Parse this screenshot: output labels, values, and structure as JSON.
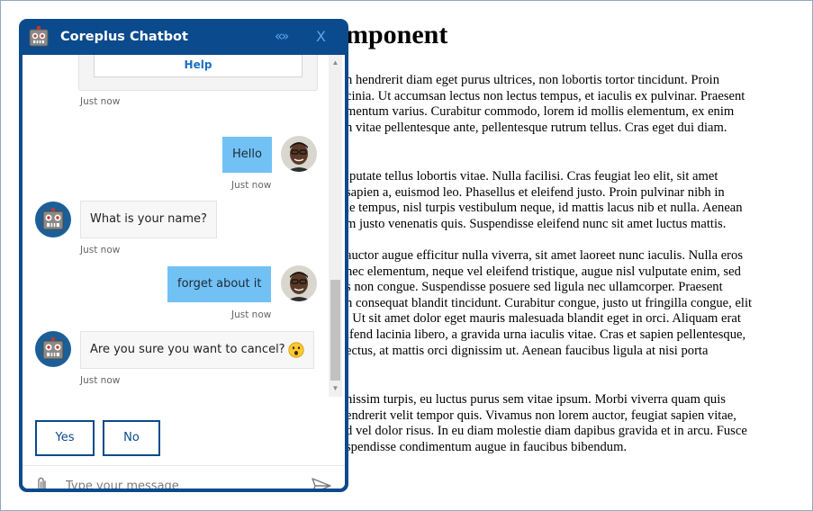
{
  "page": {
    "heading": "mponent",
    "paragraphs": [
      [
        "n hendrerit diam eget purus ultrices, non lobortis tortor tincidunt. Proin",
        "cinia. Ut accumsan lectus non lectus tempus, et iaculis ex pulvinar. Praesent",
        "mentum varius. Curabitur commodo, lorem id mollis elementum, ex enim",
        "n vitae pellentesque ante, pellentesque rutrum tellus. Cras eget dui diam."
      ],
      [
        "lputate tellus lobortis vitae. Nulla facilisi. Cras feugiat leo elit, sit amet",
        "sapien a, euismod leo. Phasellus et eleifend justo. Proin pulvinar nibh in",
        "ie tempus, nisl turpis vestibulum neque, id mattis lacus nib et nulla. Aenean",
        "m justo venenatis quis. Suspendisse eleifend nunc sit amet luctus mattis."
      ],
      [
        "auctor augue efficitur nulla viverra, sit amet laoreet nunc iaculis. Nulla eros",
        "nec elementum, neque vel eleifend tristique, augue nisl vulputate enim, sed",
        "s non congue. Suspendisse posuere sed ligula nec ullamcorper. Praesent",
        "n consequat blandit tincidunt. Curabitur congue, justo ut fringilla congue, elit",
        ". Ut sit amet dolor eget mauris malesuada blandit eget in orci. Aliquam erat",
        "ifend lacinia libero, a gravida urna iaculis vitae. Cras et sapien pellentesque,",
        "ectus, at mattis orci dignissim ut. Aenean faucibus ligula at nisi porta"
      ],
      [
        "nissim turpis, eu luctus purus sem vitae ipsum. Morbi viverra quam quis",
        "endrerit velit tempor quis. Vivamus non lorem auctor, feugiat sapien vitae,",
        "d vel dolor risus. In eu diam molestie diam dapibus gravida et in arcu. Fusce",
        "spendisse condimentum augue in faucibus bibendum."
      ]
    ]
  },
  "chat": {
    "title": "Coreplus Chatbot",
    "expand_label": "«»",
    "close_label": "X",
    "card_button_label": "Help",
    "messages": [
      {
        "from": "bot",
        "timestamp": "Just now"
      },
      {
        "from": "user",
        "text": "Hello",
        "timestamp": "Just now"
      },
      {
        "from": "bot",
        "text": "What is your name?",
        "timestamp": "Just now"
      },
      {
        "from": "user",
        "text": "forget about it",
        "timestamp": "Just now"
      },
      {
        "from": "bot",
        "text": "Are you sure you want to cancel?",
        "emoji": "astonished-face",
        "timestamp": "Just now"
      }
    ],
    "actions": {
      "yes": "Yes",
      "no": "No"
    },
    "input": {
      "placeholder": "Type your message",
      "value": ""
    },
    "colors": {
      "header": "#0b4a8c",
      "user_bubble": "#72c1f5",
      "header_icon": "#5aa5f0"
    }
  }
}
